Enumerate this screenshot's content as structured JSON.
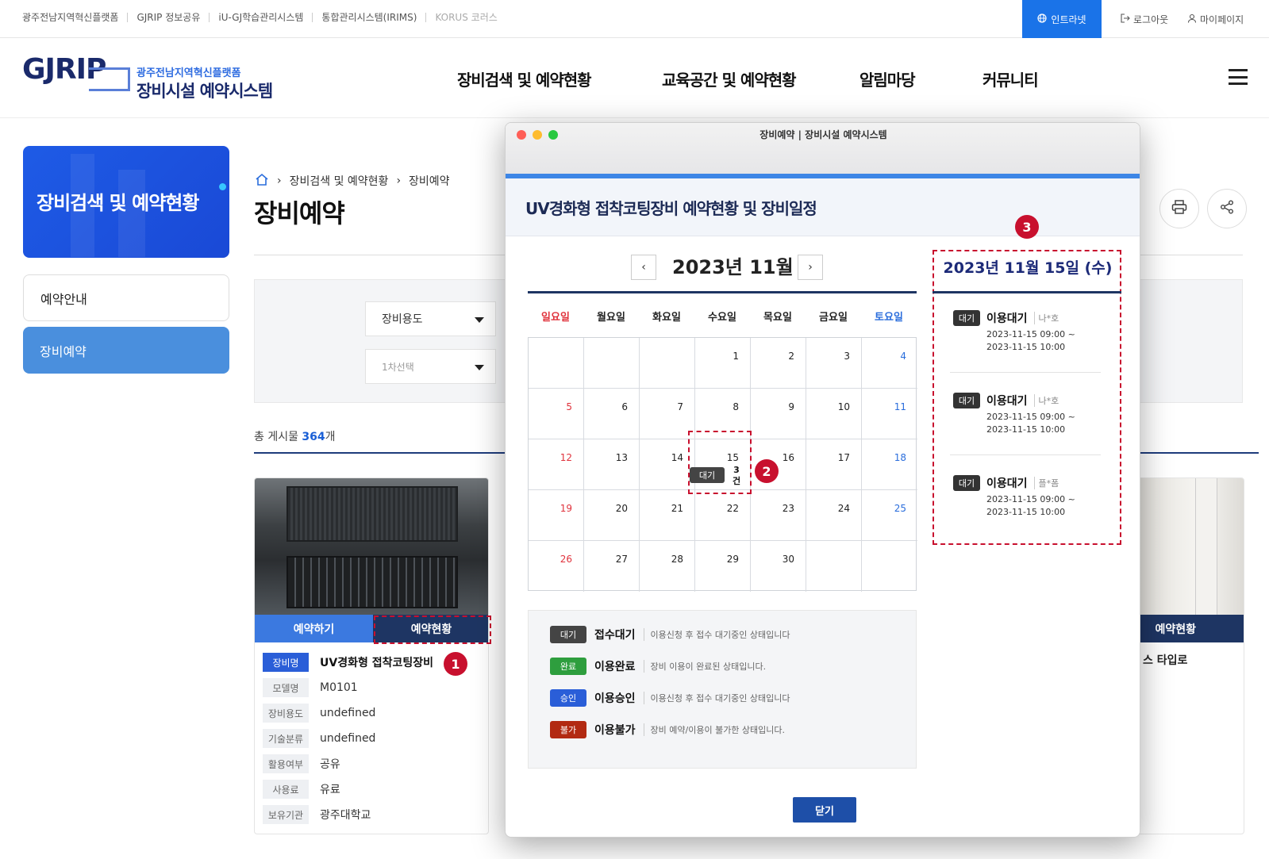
{
  "topbar": {
    "links": [
      "광주전남지역혁신플랫폼",
      "GJRIP 정보공유",
      "iU-GJ학습관리시스템",
      "통합관리시스템(IRIMS)",
      "KORUS 코러스"
    ],
    "intranet": "인트라넷",
    "logout": "로그아웃",
    "mypage": "마이페이지",
    "accent_color": "#1a73e8"
  },
  "header": {
    "logo_mark": "GJRIP",
    "logo_sub": "광주전남지역혁신플랫폼",
    "logo_title": "장비시설 예약시스템",
    "nav": [
      "장비검색 및 예약현황",
      "교육공간 및 예약현황",
      "알림마당",
      "커뮤니티"
    ]
  },
  "sidebar": {
    "hero_title": "장비검색 및 예약현황",
    "items": [
      {
        "label": "예약안내",
        "active": false
      },
      {
        "label": "장비예약",
        "active": true
      }
    ]
  },
  "content": {
    "breadcrumb": [
      "장비검색 및 예약현황",
      "장비예약"
    ],
    "title": "장비예약",
    "filters": {
      "purpose": "장비용도",
      "first": "1차선택"
    },
    "total_prefix": "총 게시물 ",
    "total_count": "364",
    "total_suffix": "개"
  },
  "card": {
    "reserve_btn": "예약하기",
    "status_btn": "예약현황",
    "specs": [
      {
        "key": "장비명",
        "value": "UV경화형 접착코팅장비"
      },
      {
        "key": "모델명",
        "value": "M0101"
      },
      {
        "key": "장비용도",
        "value": "undefined"
      },
      {
        "key": "기술분류",
        "value": "undefined"
      },
      {
        "key": "활용여부",
        "value": "공유"
      },
      {
        "key": "사용료",
        "value": "유료"
      },
      {
        "key": "보유기관",
        "value": "광주대학교"
      }
    ]
  },
  "card2": {
    "status_btn": "예약현황",
    "name_partial": "스 타입로"
  },
  "modal": {
    "window_title": "장비예약 | 장비시설 예약시스템",
    "heading": "UV경화형 접착코팅장비 예약현황 및 장비일정",
    "month": "2023년 11월",
    "prev": "‹",
    "next": "›",
    "weekdays": [
      "일요일",
      "월요일",
      "화요일",
      "수요일",
      "목요일",
      "금요일",
      "토요일"
    ],
    "first_weekday": 3,
    "days_in_month": 30,
    "event": {
      "day": 15,
      "badge": "대기",
      "count": "3",
      "unit": "건"
    },
    "selected_date": "2023년 11월 15일 (수)",
    "reservations": [
      {
        "badge": "대기",
        "status": "이용대기",
        "who": "나*호",
        "start": "2023-11-15 09:00 ~",
        "end": "2023-11-15 10:00"
      },
      {
        "badge": "대기",
        "status": "이용대기",
        "who": "나*호",
        "start": "2023-11-15 09:00 ~",
        "end": "2023-11-15 10:00"
      },
      {
        "badge": "대기",
        "status": "이용대기",
        "who": "플*폼",
        "start": "2023-11-15 09:00 ~",
        "end": "2023-11-15 10:00"
      }
    ],
    "legend": [
      {
        "badge": "대기",
        "name": "접수대기",
        "desc": "이용신청 후 접수 대기중인 상태입니다",
        "color": "#444444"
      },
      {
        "badge": "완료",
        "name": "이용완료",
        "desc": "장비 이용이 완료된 상태입니다.",
        "color": "#2e9e3e"
      },
      {
        "badge": "승인",
        "name": "이용승인",
        "desc": "이용신청 후 접수 대기중인 상태입니다",
        "color": "#2a5ed8"
      },
      {
        "badge": "불가",
        "name": "이용불가",
        "desc": "장비 예약/이용이 불가한 상태입니다.",
        "color": "#b22a12"
      }
    ],
    "close": "닫기",
    "sunday_color": "#e0323c",
    "saturday_color": "#2a6ddc"
  },
  "markers": [
    "1",
    "2",
    "3"
  ]
}
